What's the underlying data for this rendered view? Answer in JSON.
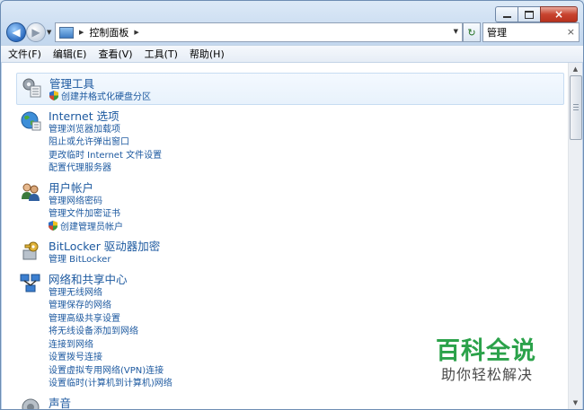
{
  "window": {
    "caption_minimize": "minimize",
    "caption_maximize": "maximize",
    "caption_close": "×"
  },
  "navigation": {
    "breadcrumb": [
      "控制面板"
    ],
    "search_value": "管理",
    "clear_glyph": "×",
    "refresh_icon": "refresh-icon",
    "back_icon": "arrow-left-icon",
    "forward_icon": "arrow-right-icon"
  },
  "menu": [
    "文件(F)",
    "编辑(E)",
    "查看(V)",
    "工具(T)",
    "帮助(H)"
  ],
  "categories": [
    {
      "title": "管理工具",
      "icon": "admin-tools-icon",
      "highlighted": true,
      "links": [
        {
          "label": "创建并格式化硬盘分区",
          "shield": true
        }
      ]
    },
    {
      "title": "Internet 选项",
      "icon": "internet-globe-icon",
      "highlighted": false,
      "links": [
        {
          "label": "管理浏览器加载项",
          "shield": false
        },
        {
          "label": "阻止或允许弹出窗口",
          "shield": false
        },
        {
          "label": "更改临时 Internet 文件设置",
          "shield": false
        },
        {
          "label": "配置代理服务器",
          "shield": false
        }
      ]
    },
    {
      "title": "用户帐户",
      "icon": "user-accounts-icon",
      "highlighted": false,
      "links": [
        {
          "label": "管理网络密码",
          "shield": false
        },
        {
          "label": "管理文件加密证书",
          "shield": false
        },
        {
          "label": "创建管理员帐户",
          "shield": true
        }
      ]
    },
    {
      "title": "BitLocker 驱动器加密",
      "icon": "bitlocker-key-icon",
      "highlighted": false,
      "links": [
        {
          "label": "管理 BitLocker",
          "shield": false
        }
      ]
    },
    {
      "title": "网络和共享中心",
      "icon": "network-icon",
      "highlighted": false,
      "links": [
        {
          "label": "管理无线网络",
          "shield": false
        },
        {
          "label": "管理保存的网络",
          "shield": false
        },
        {
          "label": "管理高级共享设置",
          "shield": false
        },
        {
          "label": "将无线设备添加到网络",
          "shield": false
        },
        {
          "label": "连接到网络",
          "shield": false
        },
        {
          "label": "设置拨号连接",
          "shield": false
        },
        {
          "label": "设置虚拟专用网络(VPN)连接",
          "shield": false
        },
        {
          "label": "设置临时(计算机到计算机)网络",
          "shield": false
        }
      ]
    },
    {
      "title": "声音",
      "icon": "sound-speaker-icon",
      "highlighted": false,
      "links": []
    }
  ],
  "watermark": {
    "title": "百科全说",
    "subtitle": "助你轻松解决"
  },
  "colors": {
    "link": "#1e5aa0",
    "watermark_green": "#2ba24a"
  }
}
